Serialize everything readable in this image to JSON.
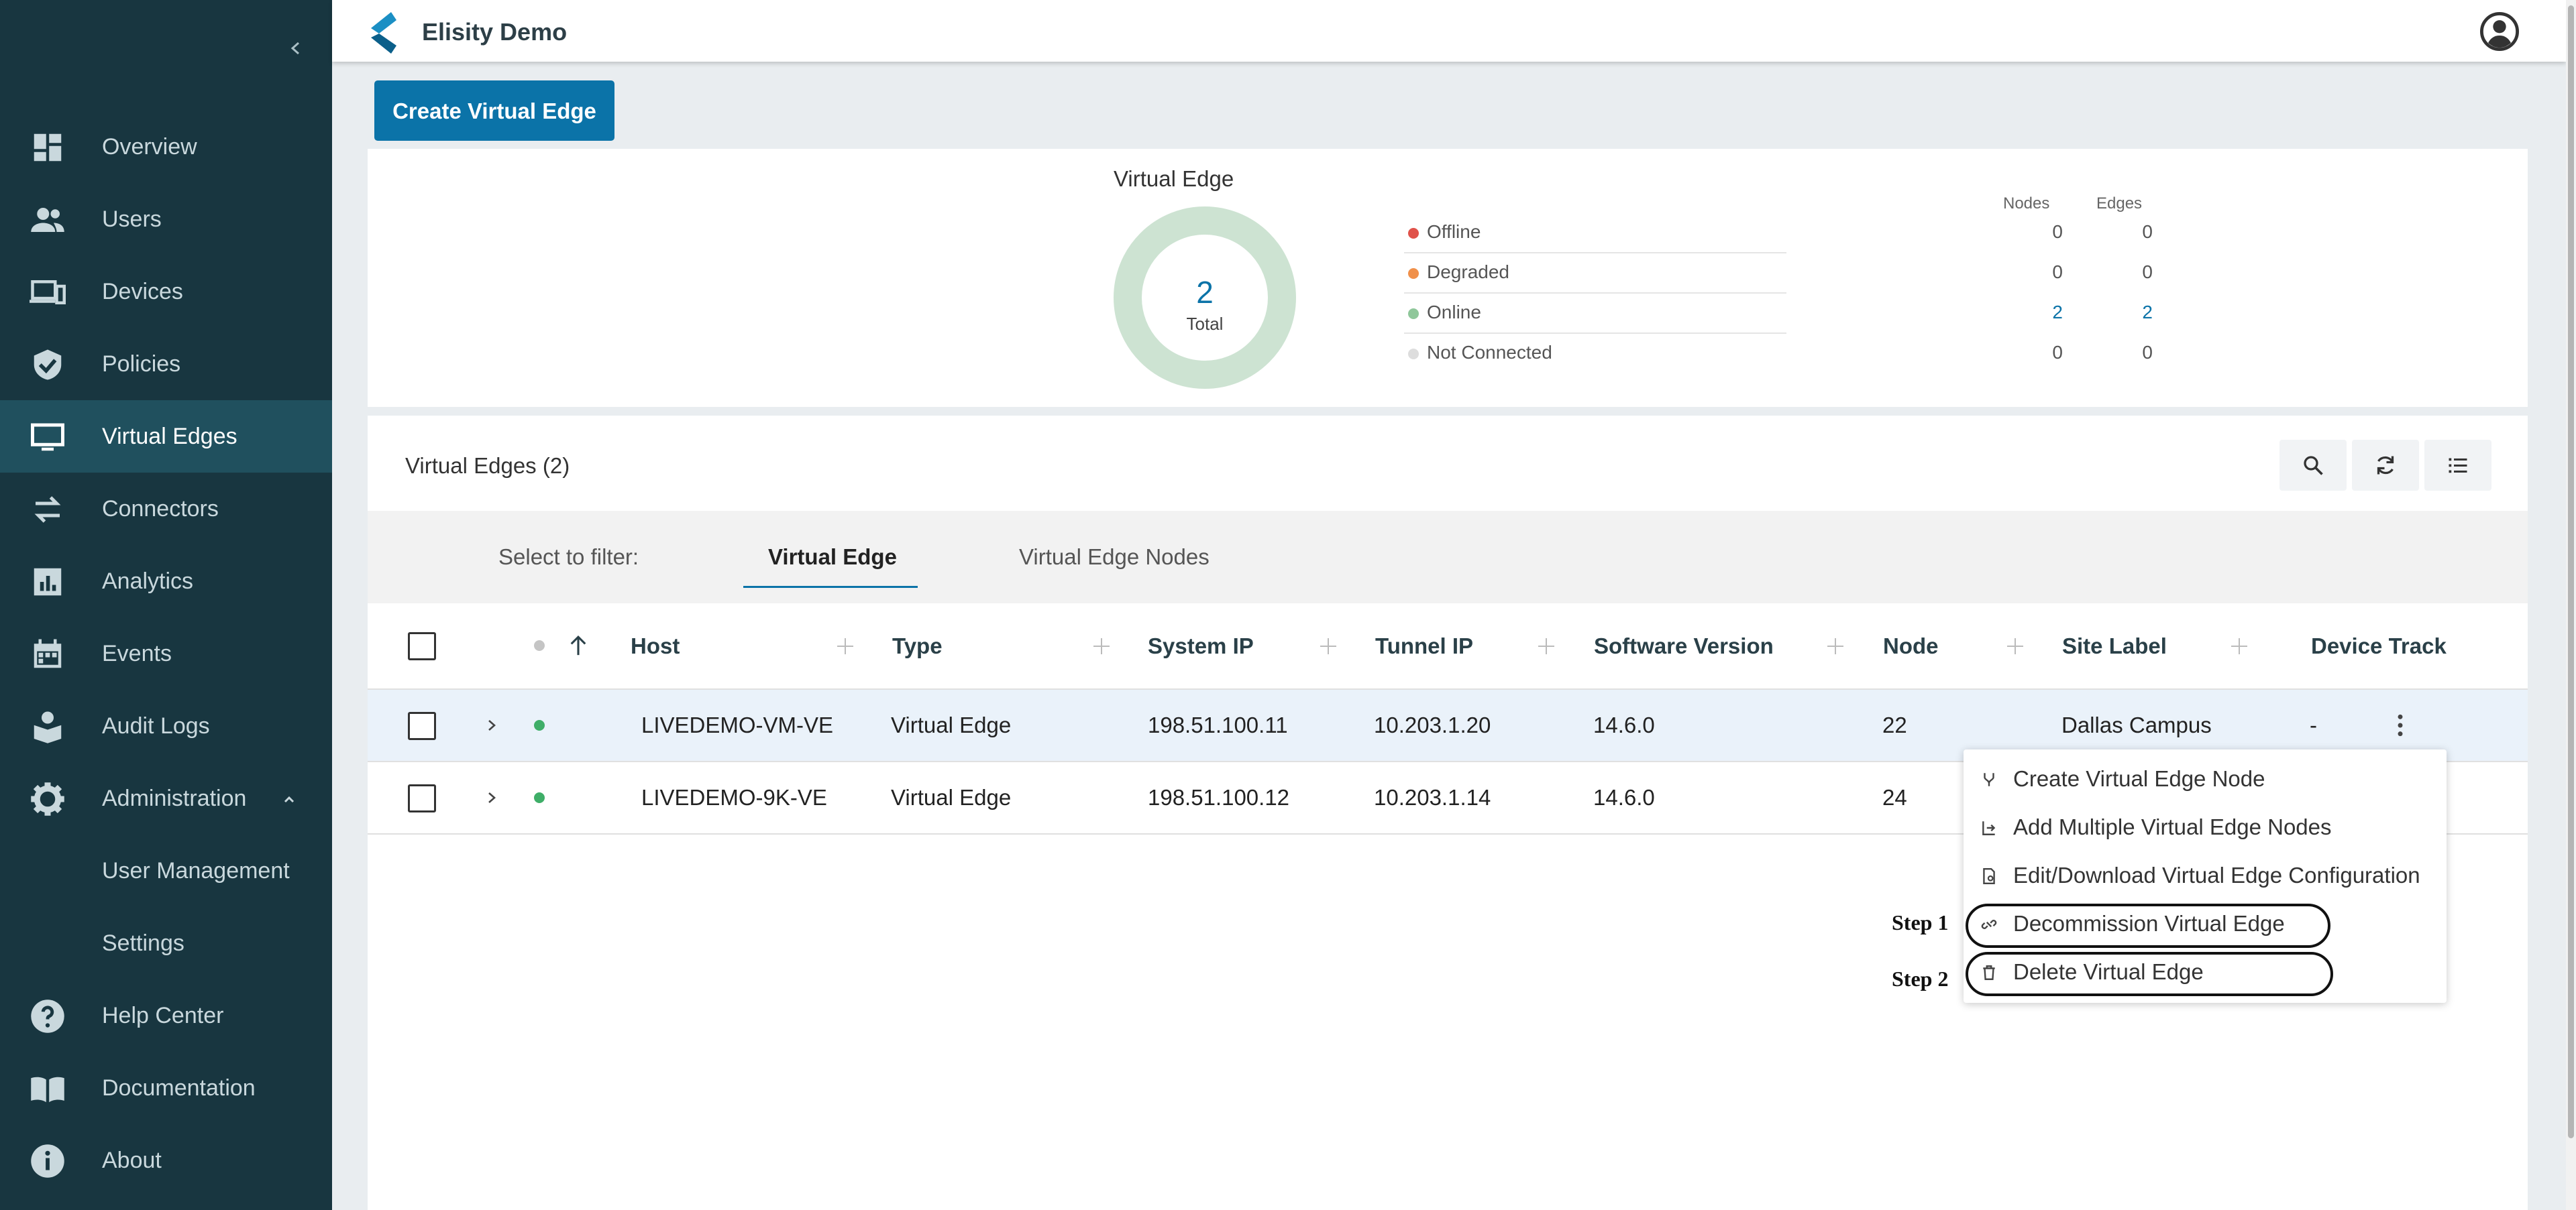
{
  "app": {
    "brand": "Elisity Demo"
  },
  "sidebar": {
    "items": [
      {
        "label": "Overview",
        "icon": "dashboard-icon"
      },
      {
        "label": "Users",
        "icon": "users-icon"
      },
      {
        "label": "Devices",
        "icon": "devices-icon"
      },
      {
        "label": "Policies",
        "icon": "shield-icon"
      },
      {
        "label": "Virtual Edges",
        "icon": "monitor-icon",
        "active": true
      },
      {
        "label": "Connectors",
        "icon": "swap-arrows-icon"
      },
      {
        "label": "Analytics",
        "icon": "bar-chart-icon"
      },
      {
        "label": "Events",
        "icon": "calendar-icon"
      },
      {
        "label": "Audit Logs",
        "icon": "audit-log-icon"
      },
      {
        "label": "Administration",
        "icon": "gear-icon",
        "expanded": true
      },
      {
        "label": "User Management",
        "sub": true
      },
      {
        "label": "Settings",
        "sub": true
      },
      {
        "label": "Help Center",
        "icon": "help-icon"
      },
      {
        "label": "Documentation",
        "icon": "book-icon"
      },
      {
        "label": "About",
        "icon": "info-icon"
      }
    ]
  },
  "toolbar": {
    "create_label": "Create Virtual Edge"
  },
  "summary": {
    "title": "Virtual Edge",
    "total_value": "2",
    "total_label": "Total",
    "col_nodes": "Nodes",
    "col_edges": "Edges",
    "rows": [
      {
        "label": "Offline",
        "nodes": "0",
        "edges": "0",
        "color": "#e0524a"
      },
      {
        "label": "Degraded",
        "nodes": "0",
        "edges": "0",
        "color": "#f0904a"
      },
      {
        "label": "Online",
        "nodes": "2",
        "edges": "2",
        "color": "#8fc79a"
      },
      {
        "label": "Not Connected",
        "nodes": "0",
        "edges": "0",
        "color": "#dddddd"
      }
    ]
  },
  "list": {
    "title": "Virtual Edges (2)",
    "filter_label": "Select to filter:",
    "tabs": [
      "Virtual Edge",
      "Virtual Edge Nodes"
    ],
    "columns": [
      "Host",
      "Type",
      "System IP",
      "Tunnel IP",
      "Software Version",
      "Node",
      "Site Label",
      "Device Track"
    ],
    "rows": [
      {
        "host": "LIVEDEMO-VM-VE",
        "type": "Virtual Edge",
        "system_ip": "198.51.100.11",
        "tunnel_ip": "10.203.1.20",
        "version": "14.6.0",
        "node": "22",
        "site": "Dallas Campus",
        "track": "-"
      },
      {
        "host": "LIVEDEMO-9K-VE",
        "type": "Virtual Edge",
        "system_ip": "198.51.100.12",
        "tunnel_ip": "10.203.1.14",
        "version": "14.6.0",
        "node": "24",
        "site": "",
        "track": ""
      }
    ]
  },
  "menu": {
    "items": [
      {
        "label": "Create Virtual Edge Node",
        "icon": "fork-icon"
      },
      {
        "label": "Add Multiple Virtual Edge Nodes",
        "icon": "add-multiple-icon"
      },
      {
        "label": "Edit/Download Virtual Edge Configuration",
        "icon": "config-file-icon"
      },
      {
        "label": "Decommission Virtual Edge",
        "icon": "unlink-icon"
      },
      {
        "label": "Delete Virtual Edge",
        "icon": "trash-icon"
      }
    ]
  },
  "annotations": {
    "step1": "Step 1",
    "step2": "Step 2"
  },
  "colors": {
    "sidebar": "#183640",
    "sidebar_active": "#20505e",
    "accent": "#0b73a8",
    "online": "#3fae68"
  }
}
